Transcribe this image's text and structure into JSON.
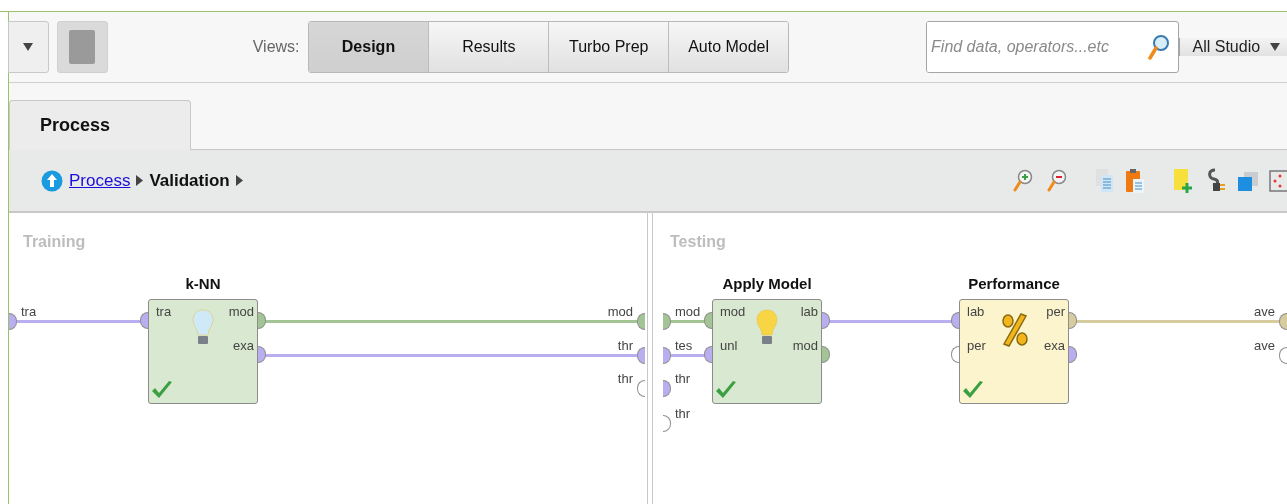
{
  "toolbar": {
    "views_label": "Views:",
    "views": [
      {
        "label": "Design",
        "selected": true
      },
      {
        "label": "Results",
        "selected": false
      },
      {
        "label": "Turbo Prep",
        "selected": false
      },
      {
        "label": "Auto Model",
        "selected": false
      }
    ],
    "search": {
      "placeholder": "Find data, operators...etc"
    },
    "scope": "All Studio"
  },
  "tabs": [
    {
      "label": "Process",
      "selected": true
    }
  ],
  "breadcrumb": [
    {
      "label": "Process",
      "kind": "link"
    },
    {
      "label": "Validation",
      "kind": "current"
    }
  ],
  "panels": [
    {
      "title": "Training",
      "inputs": [
        {
          "label": "tra",
          "color": "#b9aef0"
        }
      ],
      "outputs": [
        {
          "label": "mod",
          "color": "#a3c495"
        },
        {
          "label": "thr",
          "color": "#b9aef0"
        },
        {
          "label": "thr",
          "color": "#ffffff"
        }
      ],
      "operators": [
        {
          "name": "k-NN",
          "kind": "learner",
          "inputs": [
            {
              "label": "tra",
              "color": "#b9aef0"
            }
          ],
          "outputs": [
            {
              "label": "mod",
              "color": "#a3c495"
            },
            {
              "label": "exa",
              "color": "#b9aef0"
            }
          ]
        }
      ]
    },
    {
      "title": "Testing",
      "inputs": [
        {
          "label": "mod",
          "color": "#a3c495"
        },
        {
          "label": "tes",
          "color": "#b9aef0"
        },
        {
          "label": "thr",
          "color": "#b9aef0"
        },
        {
          "label": "thr",
          "color": "#ffffff"
        }
      ],
      "outputs": [
        {
          "label": "ave",
          "color": "#d6cc9e"
        },
        {
          "label": "ave",
          "color": "#ffffff"
        }
      ],
      "operators": [
        {
          "name": "Apply Model",
          "kind": "apply",
          "inputs": [
            {
              "label": "mod",
              "color": "#a3c495"
            },
            {
              "label": "unl",
              "color": "#b9aef0"
            }
          ],
          "outputs": [
            {
              "label": "lab",
              "color": "#b9aef0"
            },
            {
              "label": "mod",
              "color": "#a3c495"
            }
          ]
        },
        {
          "name": "Performance",
          "kind": "performance",
          "inputs": [
            {
              "label": "lab",
              "color": "#b9aef0"
            },
            {
              "label": "per",
              "color": "#ffffff"
            }
          ],
          "outputs": [
            {
              "label": "per",
              "color": "#d6cc9e"
            },
            {
              "label": "exa",
              "color": "#b9aef0"
            }
          ]
        }
      ]
    }
  ]
}
